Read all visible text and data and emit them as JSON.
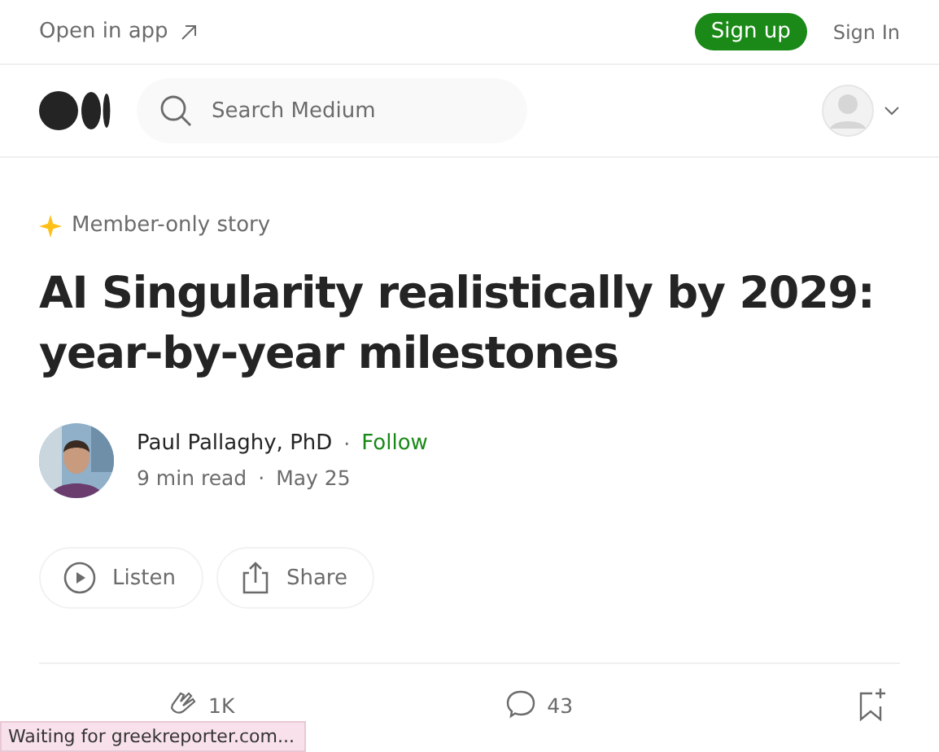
{
  "top_bar": {
    "open_in_app": "Open in app",
    "sign_up": "Sign up",
    "sign_in": "Sign In"
  },
  "nav": {
    "search": {
      "placeholder": "Search Medium"
    }
  },
  "article": {
    "badge": "Member-only story",
    "title": "AI Singularity realistically by 2029: year-by-year milestones",
    "author": {
      "name": "Paul Pallaghy, PhD",
      "separator": "·",
      "follow": "Follow",
      "read_time": "9 min read",
      "date_separator": "·",
      "date": "May 25"
    },
    "actions": [
      {
        "kind": "listen",
        "label": "Listen"
      },
      {
        "kind": "share",
        "label": "Share"
      }
    ],
    "stats": {
      "claps": "1K",
      "comments": "43"
    }
  },
  "status_bar": "Waiting for greekreporter.com..."
}
